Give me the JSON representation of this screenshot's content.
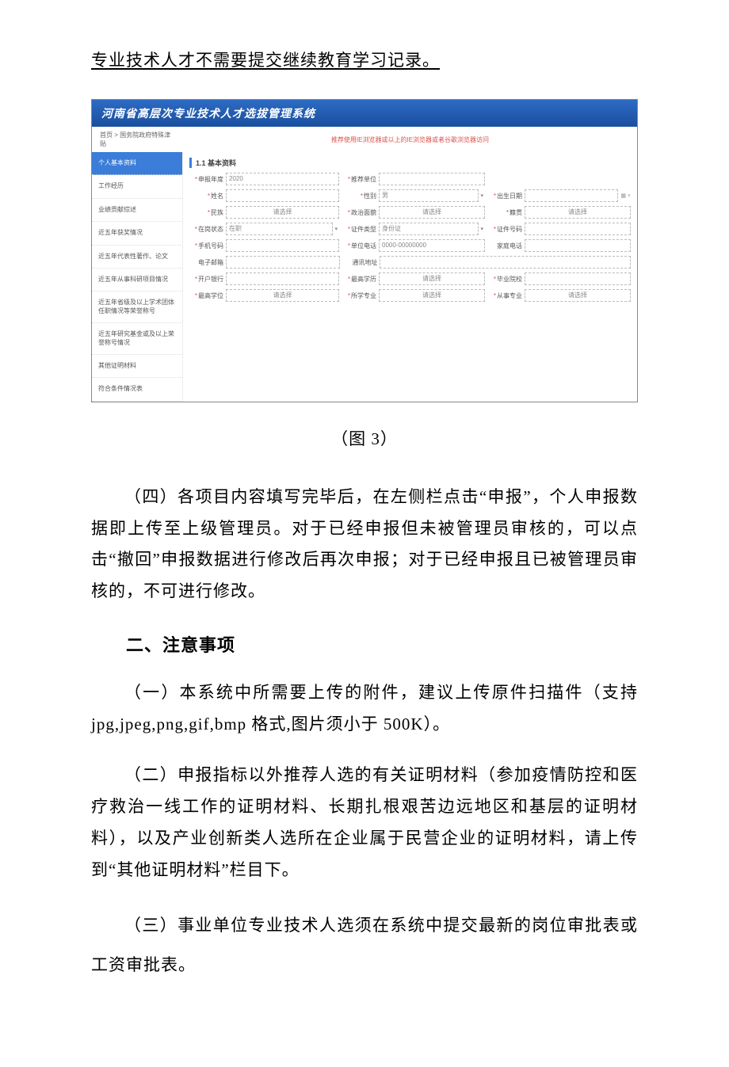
{
  "top_line": "专业技术人才不需要提交继续教育学习记录。",
  "screenshot": {
    "header": "河南省高层次专业技术人才选拔管理系统",
    "breadcrumb": "首页 > 国务院政府特殊津贴",
    "warning": "推荐使用IE浏览器或以上的IE浏览器或者谷歌浏览器访问",
    "sidebar": {
      "items": [
        "个人基本资料",
        "工作经历",
        "业绩贡献综述",
        "近五年获奖情况",
        "近五年代表性著作、论文",
        "近五年从事科研项目情况",
        "近五年省级及以上学术团体任职情况等荣誉称号",
        "近五年研究基金或及以上荣誉称号情况",
        "其他证明材料",
        "符合条件情况表"
      ]
    },
    "section_title": "1.1 基本资料",
    "fields": {
      "apply_year_label": "申报年度",
      "apply_year_value": "2020",
      "rec_unit_label": "推荐单位",
      "rec_unit_value": "",
      "name_label": "姓名",
      "gender_label": "性别",
      "gender_value": "男",
      "birth_label": "出生日期",
      "nation_label": "民族",
      "nation_ph": "请选择",
      "political_label": "政治面貌",
      "political_ph": "请选择",
      "native_label": "籍贯",
      "native_ph": "请选择",
      "onjob_label": "在岗状态",
      "onjob_value": "在职",
      "idtype_label": "证件类型",
      "idtype_value": "身份证",
      "idno_label": "证件号码",
      "mobile_label": "手机号码",
      "unit_tel_label": "单位电话",
      "unit_tel_ph": "0000-00000000",
      "home_tel_label": "家庭电话",
      "email_label": "电子邮箱",
      "addr_label": "通讯地址",
      "bank_label": "开户银行",
      "edu_label": "最高学历",
      "edu_ph": "请选择",
      "school_label": "毕业院校",
      "degree_label": "最高学位",
      "degree_ph": "请选择",
      "major_label": "所学专业",
      "major_ph": "请选择",
      "work_major_label": "从事专业",
      "work_major_ph": "请选择"
    }
  },
  "figure_caption": "（图 3）",
  "para4": "（四）各项目内容填写完毕后，在左侧栏点击“申报”，个人申报数据即上传至上级管理员。对于已经申报但未被管理员审核的，可以点击“撤回”申报数据进行修改后再次申报；对于已经申报且已被管理员审核的，不可进行修改。",
  "heading2": "二、注意事项",
  "note1": "（一）本系统中所需要上传的附件，建议上传原件扫描件（支持 jpg,jpeg,png,gif,bmp 格式,图片须小于 500K）。",
  "note2": "（二）申报指标以外推荐人选的有关证明材料（参加疫情防控和医疗救治一线工作的证明材料、长期扎根艰苦边远地区和基层的证明材料），以及产业创新类人选所在企业属于民营企业的证明材料，请上传到“其他证明材料”栏目下。",
  "note3": "（三）事业单位专业技术人选须在系统中提交最新的岗位审批表或工资审批表。"
}
